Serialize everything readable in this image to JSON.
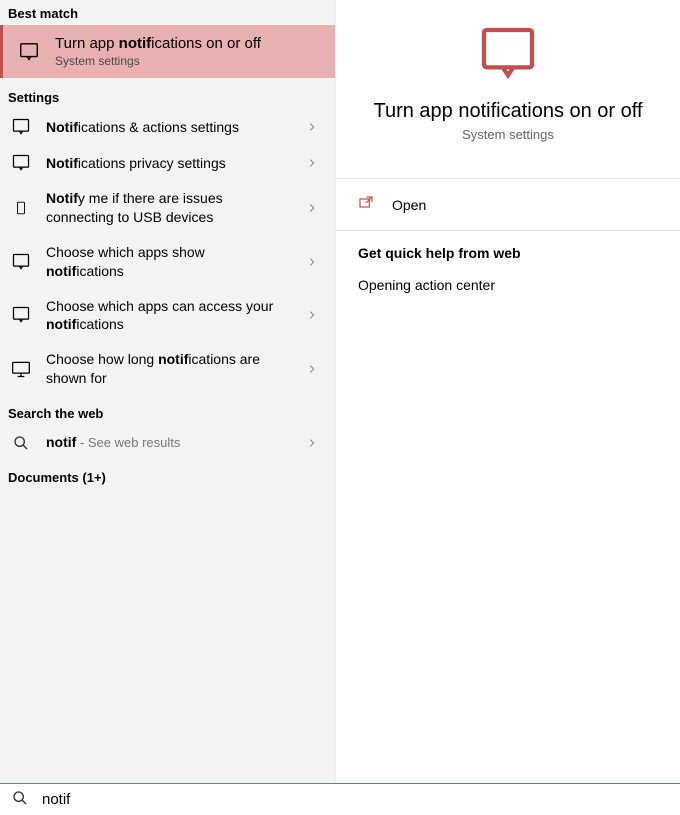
{
  "sections": {
    "best_match_label": "Best match",
    "settings_label": "Settings",
    "search_web_label": "Search the web",
    "documents_label": "Documents (1+)"
  },
  "best_match": {
    "title_pre": "Turn app ",
    "title_bold": "notif",
    "title_post": "ications on or off",
    "subtitle": "System settings"
  },
  "settings_items": [
    {
      "icon": "notification",
      "pre": "",
      "bold": "Notif",
      "post": "ications & actions settings"
    },
    {
      "icon": "notification",
      "pre": "",
      "bold": "Notif",
      "post": "ications privacy settings"
    },
    {
      "icon": "device",
      "pre": "",
      "bold": "Notif",
      "post": "y me if there are issues connecting to USB devices"
    },
    {
      "icon": "notification",
      "pre": "Choose which apps show ",
      "bold": "notif",
      "post": "ications"
    },
    {
      "icon": "notification",
      "pre": "Choose which apps can access your ",
      "bold": "notif",
      "post": "ications"
    },
    {
      "icon": "monitor",
      "pre": "Choose how long ",
      "bold": "notif",
      "post": "ications are shown for"
    }
  ],
  "web": {
    "query": "notif",
    "suffix": " - See web results"
  },
  "preview": {
    "title": "Turn app notifications on or off",
    "subtitle": "System settings",
    "open_label": "Open",
    "quick_help_header": "Get quick help from web",
    "quick_help_item": "Opening action center"
  },
  "searchbar": {
    "value": "notif"
  },
  "colors": {
    "accent": "#c0504e"
  }
}
